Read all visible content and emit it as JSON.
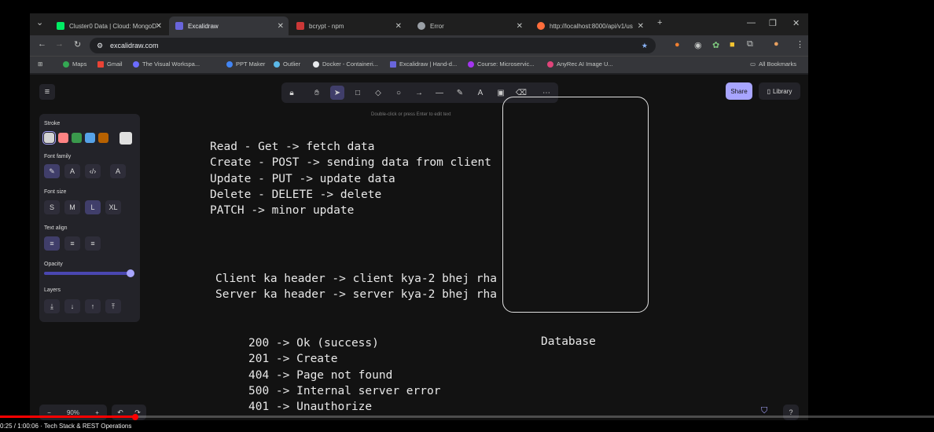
{
  "tabs": [
    {
      "label": "Cluster0 Data | Cloud: MongoD",
      "color": "#00ed64"
    },
    {
      "label": "Excalidraw",
      "color": "#6965db"
    },
    {
      "label": "bcrypt - npm",
      "color": "#cb3837"
    },
    {
      "label": "Error",
      "color": "#9aa0a6"
    },
    {
      "label": "http://localhost:8000/api/v1/us",
      "color": "#ff6d3b"
    }
  ],
  "address": "excalidraw.com",
  "bookmarks": [
    "Maps",
    "Gmail",
    "The Visual Workspa...",
    "PPT Maker",
    "Outlier",
    "Docker - Containeri...",
    "Excalidraw | Hand-d...",
    "Course: Microservic...",
    "AnyRec AI Image U...",
    "All Bookmarks"
  ],
  "hint": "Double-click or press Enter to edit text",
  "share": "Share",
  "library": "Library",
  "panel": {
    "stroke": "Stroke",
    "font_family": "Font family",
    "font_size": "Font size",
    "sizes": [
      "S",
      "M",
      "L",
      "XL"
    ],
    "text_align": "Text align",
    "opacity": "Opacity",
    "layers": "Layers",
    "colors": [
      "#d3d3d3",
      "#ff8383",
      "#3a994c",
      "#56a2e8",
      "#b76100",
      "#e0e0e0"
    ]
  },
  "tool_digits": [
    "1",
    "2",
    "3",
    "4",
    "5",
    "6",
    "7",
    "8",
    "9",
    "0"
  ],
  "text": {
    "crud": [
      "Read - Get -> fetch data",
      "Create - POST -> sending data from client",
      "Update - PUT -> update data",
      "Delete - DELETE -> delete",
      "PATCH -> minor update"
    ],
    "headers": [
      "Client ka header -> client kya-2 bhej rha",
      "Server ka header -> server kya-2 bhej rha"
    ],
    "codes": [
      "200 -> Ok (success)",
      "201 -> Create",
      "404 -> Page not found",
      "500 -> Internal server error",
      "401 -> Unauthorize"
    ],
    "db_label": "Database"
  },
  "zoom": "90%",
  "time": "0:25 / 1:00:06",
  "video_title": "Tech Stack & REST Operations",
  "progress": 0.014
}
